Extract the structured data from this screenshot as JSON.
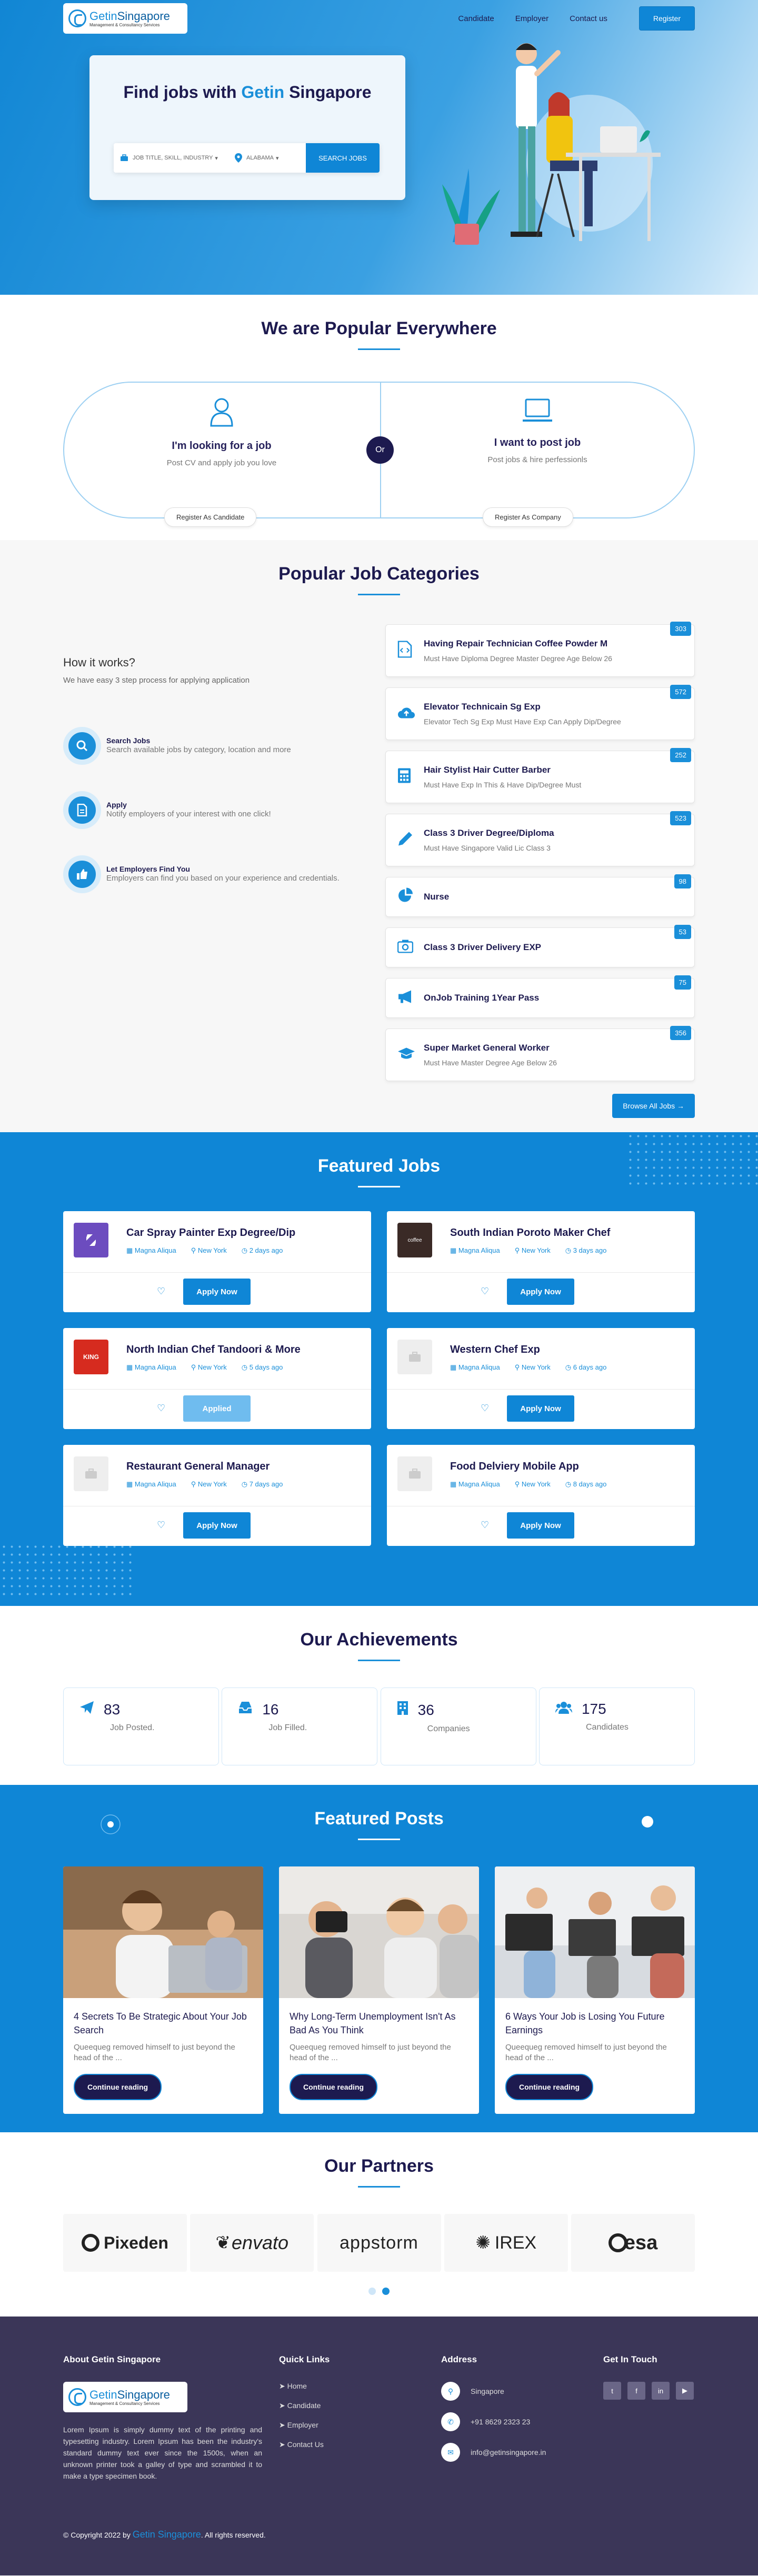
{
  "header": {
    "logo_text_main": "Getin",
    "logo_text_accent": "Singapore",
    "logo_subtitle": "Management & Consultancy Services",
    "nav": [
      "Candidate",
      "Employer",
      "Contact us"
    ],
    "register_label": "Register"
  },
  "hero": {
    "title_pre": "Find jobs with ",
    "title_accent": "Getin",
    "title_post": " Singapore",
    "search_placeholder": "JOB TITLE, SKILL, INDUSTRY",
    "location": "ALABAMA",
    "search_button": "SEARCH JOBS"
  },
  "popular": {
    "title": "We are Popular Everywhere",
    "left_title": "I'm looking for a job",
    "left_desc": "Post CV and apply job you love",
    "left_button": "Register As Candidate",
    "or": "Or",
    "right_title": "I want to post job",
    "right_desc": "Post jobs & hire perfessionls",
    "right_button": "Register As Company"
  },
  "categories": {
    "title": "Popular Job Categories",
    "how_title": "How it works?",
    "how_sub": "We have easy 3 step process for applying application",
    "steps": [
      {
        "title": "Search Jobs",
        "desc": "Search available jobs by category, location and more"
      },
      {
        "title": "Apply",
        "desc": "Notify employers of your interest with one click!"
      },
      {
        "title": "Let Employers Find You",
        "desc": "Employers can find you based on your experience and credentials."
      }
    ],
    "items": [
      {
        "title": "Having Repair Technician Coffee Powder M",
        "desc": "Must Have Diploma Degree Master Degree Age Below 26",
        "count": "303",
        "icon": "code-file-icon"
      },
      {
        "title": "Elevator Technicain Sg Exp",
        "desc": "Elevator Tech Sg Exp Must Have Exp Can Apply Dip/Degree",
        "count": "572",
        "icon": "cloud-upload-icon"
      },
      {
        "title": "Hair Stylist Hair Cutter Barber",
        "desc": "Must Have Exp In This & Have Dip/Degree Must",
        "count": "252",
        "icon": "calculator-icon"
      },
      {
        "title": "Class 3 Driver Degree/Diploma",
        "desc": "Must Have Singapore Valid Lic Class 3",
        "count": "523",
        "icon": "pen-icon"
      },
      {
        "title": "Nurse",
        "desc": "",
        "count": "98",
        "icon": "pie-chart-icon"
      },
      {
        "title": "Class 3 Driver Delivery EXP",
        "desc": "",
        "count": "53",
        "icon": "camera-icon"
      },
      {
        "title": "OnJob Training 1Year Pass",
        "desc": "",
        "count": "75",
        "icon": "megaphone-icon"
      },
      {
        "title": "Super Market General Worker",
        "desc": "Must Have Master Degree Age Below 26",
        "count": "356",
        "icon": "graduation-cap-icon"
      }
    ],
    "browse_label": "Browse All Jobs →"
  },
  "featured_jobs": {
    "title": "Featured Jobs",
    "jobs": [
      {
        "title": "Car Spray Painter Exp Degree/Dip",
        "company": "Magna Aliqua",
        "location": "New York",
        "time": "2 days ago",
        "action": "Apply Now",
        "logo_color": "#6c4cbf",
        "logo_text": "⧉"
      },
      {
        "title": "South Indian Poroto Maker Chef",
        "company": "Magna Aliqua",
        "location": "New York",
        "time": "3 days ago",
        "action": "Apply Now",
        "logo_color": "#3a2a26",
        "logo_text": "coffee"
      },
      {
        "title": "North Indian Chef Tandoori & More",
        "company": "Magna Aliqua",
        "location": "New York",
        "time": "5 days ago",
        "action": "Applied",
        "logo_color": "#d62b1f",
        "logo_text": "KING"
      },
      {
        "title": "Western Chef Exp",
        "company": "Magna Aliqua",
        "location": "New York",
        "time": "6 days ago",
        "action": "Apply Now",
        "logo_color": "#eeeeee",
        "logo_text": ""
      },
      {
        "title": "Restaurant General Manager",
        "company": "Magna Aliqua",
        "location": "New York",
        "time": "7 days ago",
        "action": "Apply Now",
        "logo_color": "#eeeeee",
        "logo_text": ""
      },
      {
        "title": "Food Delviery Mobile App",
        "company": "Magna Aliqua",
        "location": "New York",
        "time": "8 days ago",
        "action": "Apply Now",
        "logo_color": "#eeeeee",
        "logo_text": ""
      }
    ]
  },
  "achievements": {
    "title": "Our Achievements",
    "items": [
      {
        "num": "83",
        "label": "Job Posted.",
        "icon": "paper-plane-icon"
      },
      {
        "num": "16",
        "label": "Job Filled.",
        "icon": "inbox-icon"
      },
      {
        "num": "36",
        "label": "Companies",
        "icon": "building-icon"
      },
      {
        "num": "175",
        "label": "Candidates",
        "icon": "users-icon"
      }
    ]
  },
  "posts": {
    "title": "Featured Posts",
    "items": [
      {
        "title": "4 Secrets To Be Strategic About Your Job Search",
        "excerpt": "Queequeg removed himself to just beyond the head of the ...",
        "button": "Continue reading"
      },
      {
        "title": "Why Long-Term Unemployment Isn't As Bad As You Think",
        "excerpt": "Queequeg removed himself to just beyond the head of the ...",
        "button": "Continue reading"
      },
      {
        "title": "6 Ways Your Job is Losing You Future Earnings",
        "excerpt": "Queequeg removed himself to just beyond the head of the ...",
        "button": "Continue reading"
      }
    ]
  },
  "partners": {
    "title": "Our Partners",
    "logos": [
      "Pixeden",
      "envato",
      "appstorm",
      "IREX",
      "esa"
    ]
  },
  "footer": {
    "about_title": "About Getin Singapore",
    "about_text": "Lorem Ipsum is simply dummy text of the printing and typesetting industry. Lorem Ipsum has been the industry's standard dummy text ever since the 1500s, when an unknown printer took a galley of type and scrambled it to make a type specimen book.",
    "links_title": "Quick Links",
    "links": [
      "Home",
      "Candidate",
      "Employer",
      "Contact Us"
    ],
    "address_title": "Address",
    "address": "Singapore",
    "phone": "+91 8629 2323 23",
    "email": "info@getinsingapore.in",
    "touch_title": "Get In Touch",
    "social": [
      "twitter-icon",
      "facebook-icon",
      "linkedin-icon",
      "youtube-icon"
    ],
    "copy_pre": "© Copyright 2022 by ",
    "copy_brand": "Getin Singapore",
    "copy_post": ". All rights reserved."
  }
}
